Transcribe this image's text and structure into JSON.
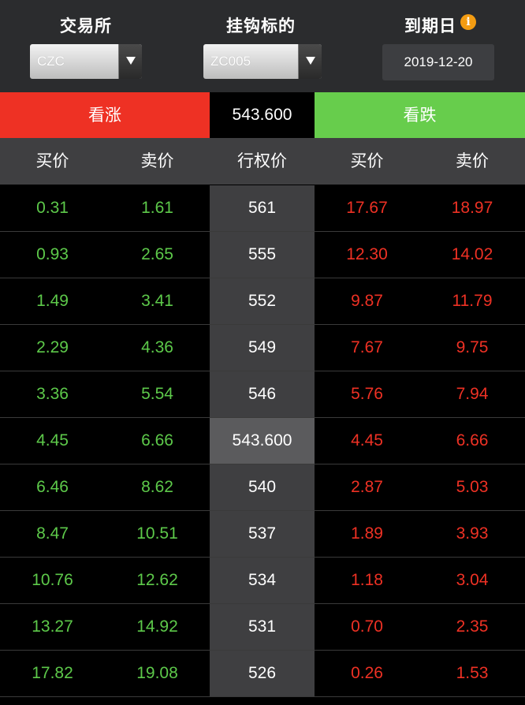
{
  "header": {
    "exchange_label": "交易所",
    "underlying_label": "挂钩标的",
    "expiry_label": "到期日",
    "exchange_value": "CZC",
    "underlying_value": "ZC005",
    "expiry_value": "2019-12-20",
    "info_icon": "i"
  },
  "tradebar": {
    "call_label": "看涨",
    "underlying_price": "543.600",
    "put_label": "看跌"
  },
  "columns": [
    "买价",
    "卖价",
    "行权价",
    "买价",
    "卖价"
  ],
  "rows": [
    {
      "call_bid": "0.31",
      "call_ask": "1.61",
      "strike": "561",
      "put_bid": "17.67",
      "put_ask": "18.97"
    },
    {
      "call_bid": "0.93",
      "call_ask": "2.65",
      "strike": "555",
      "put_bid": "12.30",
      "put_ask": "14.02"
    },
    {
      "call_bid": "1.49",
      "call_ask": "3.41",
      "strike": "552",
      "put_bid": "9.87",
      "put_ask": "11.79"
    },
    {
      "call_bid": "2.29",
      "call_ask": "4.36",
      "strike": "549",
      "put_bid": "7.67",
      "put_ask": "9.75"
    },
    {
      "call_bid": "3.36",
      "call_ask": "5.54",
      "strike": "546",
      "put_bid": "5.76",
      "put_ask": "7.94"
    },
    {
      "call_bid": "4.45",
      "call_ask": "6.66",
      "strike": "543.600",
      "put_bid": "4.45",
      "put_ask": "6.66"
    },
    {
      "call_bid": "6.46",
      "call_ask": "8.62",
      "strike": "540",
      "put_bid": "2.87",
      "put_ask": "5.03"
    },
    {
      "call_bid": "8.47",
      "call_ask": "10.51",
      "strike": "537",
      "put_bid": "1.89",
      "put_ask": "3.93"
    },
    {
      "call_bid": "10.76",
      "call_ask": "12.62",
      "strike": "534",
      "put_bid": "1.18",
      "put_ask": "3.04"
    },
    {
      "call_bid": "13.27",
      "call_ask": "14.92",
      "strike": "531",
      "put_bid": "0.70",
      "put_ask": "2.35"
    },
    {
      "call_bid": "17.82",
      "call_ask": "19.08",
      "strike": "526",
      "put_bid": "0.26",
      "put_ask": "1.53"
    }
  ],
  "colors": {
    "call_color": "#5dc94a",
    "put_color": "#ee3124",
    "up_button": "#ee3124",
    "down_button": "#67cd4c",
    "info_icon": "#f39c12"
  }
}
